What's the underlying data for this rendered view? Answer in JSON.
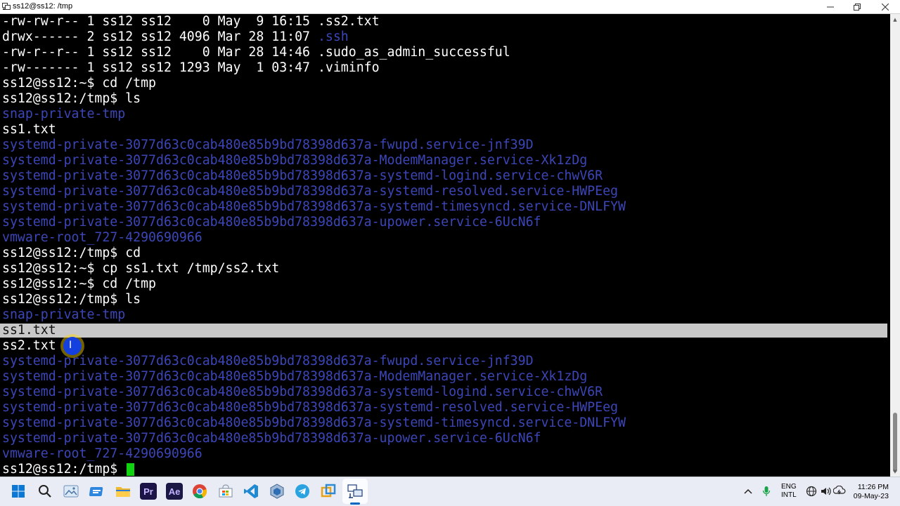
{
  "window": {
    "title": "ss12@ss12: /tmp"
  },
  "terminal": {
    "lines": [
      {
        "text": "-rw-rw-r-- 1 ss12 ss12    0 May  9 16:15 ",
        "tail": ".ss2.txt",
        "tail_color": "white"
      },
      {
        "text": "drwx------ 2 ss12 ss12 4096 Mar 28 11:07 ",
        "tail": ".ssh",
        "tail_color": "blue"
      },
      {
        "text": "-rw-r--r-- 1 ss12 ss12    0 Mar 28 14:46 ",
        "tail": ".sudo_as_admin_successful",
        "tail_color": "white"
      },
      {
        "text": "-rw------- 1 ss12 ss12 1293 May  1 03:47 ",
        "tail": ".viminfo",
        "tail_color": "white"
      },
      {
        "text": "ss12@ss12:~$ cd /tmp",
        "color": "white"
      },
      {
        "text": "ss12@ss12:/tmp$ ls",
        "color": "white"
      },
      {
        "text": "snap-private-tmp",
        "color": "blue"
      },
      {
        "text": "ss1.txt",
        "color": "white"
      },
      {
        "text": "systemd-private-3077d63c0cab480e85b9bd78398d637a-fwupd.service-jnf39D",
        "color": "blue"
      },
      {
        "text": "systemd-private-3077d63c0cab480e85b9bd78398d637a-ModemManager.service-Xk1zDg",
        "color": "blue"
      },
      {
        "text": "systemd-private-3077d63c0cab480e85b9bd78398d637a-systemd-logind.service-chwV6R",
        "color": "blue"
      },
      {
        "text": "systemd-private-3077d63c0cab480e85b9bd78398d637a-systemd-resolved.service-HWPEeg",
        "color": "blue"
      },
      {
        "text": "systemd-private-3077d63c0cab480e85b9bd78398d637a-systemd-timesyncd.service-DNLFYW",
        "color": "blue"
      },
      {
        "text": "systemd-private-3077d63c0cab480e85b9bd78398d637a-upower.service-6UcN6f",
        "color": "blue"
      },
      {
        "text": "vmware-root_727-4290690966",
        "color": "blue"
      },
      {
        "text": "ss12@ss12:/tmp$ cd",
        "color": "white"
      },
      {
        "text": "ss12@ss12:~$ cp ss1.txt /tmp/ss2.txt",
        "color": "white"
      },
      {
        "text": "ss12@ss12:~$ cd /tmp",
        "color": "white"
      },
      {
        "text": "ss12@ss12:/tmp$ ls",
        "color": "white"
      },
      {
        "text": "snap-private-tmp",
        "color": "blue"
      },
      {
        "text": "ss1.txt",
        "color": "selected"
      },
      {
        "text": "ss2.txt",
        "color": "white"
      },
      {
        "text": "systemd-private-3077d63c0cab480e85b9bd78398d637a-fwupd.service-jnf39D",
        "color": "blue"
      },
      {
        "text": "systemd-private-3077d63c0cab480e85b9bd78398d637a-ModemManager.service-Xk1zDg",
        "color": "blue"
      },
      {
        "text": "systemd-private-3077d63c0cab480e85b9bd78398d637a-systemd-logind.service-chwV6R",
        "color": "blue"
      },
      {
        "text": "systemd-private-3077d63c0cab480e85b9bd78398d637a-systemd-resolved.service-HWPEeg",
        "color": "blue"
      },
      {
        "text": "systemd-private-3077d63c0cab480e85b9bd78398d637a-systemd-timesyncd.service-DNLFYW",
        "color": "blue"
      },
      {
        "text": "systemd-private-3077d63c0cab480e85b9bd78398d637a-upower.service-6UcN6f",
        "color": "blue"
      },
      {
        "text": "vmware-root_727-4290690966",
        "color": "blue"
      }
    ],
    "prompt": "ss12@ss12:/tmp$ ",
    "colors": {
      "blue": "#3c46b8",
      "white": "#ffffff",
      "cursor": "#11d411",
      "selection": "#c8c8c8"
    }
  },
  "taskbar": {
    "icons": [
      "windows-start-icon",
      "search-icon",
      "photos-icon",
      "file-explorer-icon",
      "folder-icon",
      "premiere-pro-icon",
      "after-effects-icon",
      "chrome-icon",
      "store-icon",
      "vscode-icon",
      "virtualbox-icon",
      "telegram-icon",
      "snipping-tool-icon",
      "network-terminal-icon"
    ],
    "premiere_label": "Pr",
    "after_effects_label": "Ae",
    "language": {
      "line1": "ENG",
      "line2": "INTL"
    },
    "clock": {
      "time": "11:26 PM",
      "date": "09-May-23"
    }
  }
}
